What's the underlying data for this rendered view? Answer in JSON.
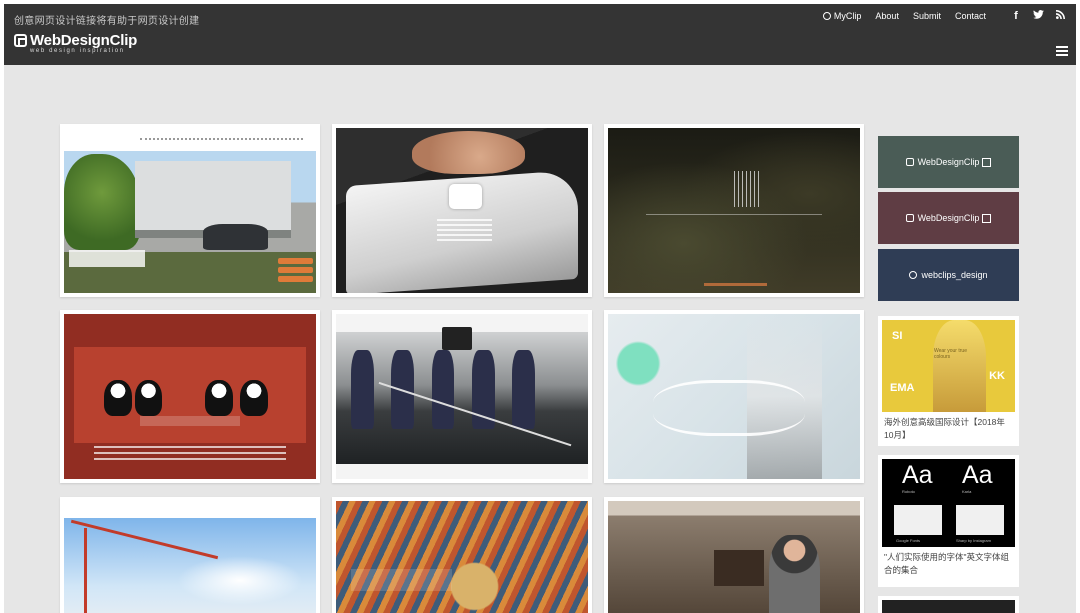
{
  "header": {
    "tagline": "创意网页设计链接将有助于网页设计创建",
    "logo_text": "WebDesignClip",
    "logo_sub": "web design inspiration",
    "nav": [
      {
        "label": "MyClip",
        "icon": "myclip-icon"
      },
      {
        "label": "About"
      },
      {
        "label": "Submit"
      },
      {
        "label": "Contact"
      }
    ],
    "social": [
      "facebook-icon",
      "twitter-icon",
      "rss-icon"
    ],
    "menu_icon": "hamburger-menu-icon",
    "bg_color": "#343434"
  },
  "sidebar": {
    "links": [
      {
        "label": "WebDesignClip",
        "color": "#4a5c56",
        "icon": "webdesignclip-logo-icon"
      },
      {
        "label": "WebDesignClip",
        "color": "#5f3d44",
        "icon": "webdesignclip-logo-icon"
      },
      {
        "label": "webclips_design",
        "color": "#2f3d55",
        "icon": "instagram-icon"
      }
    ],
    "posts": [
      {
        "caption": "海外创意高级国际设计【2018年10月】",
        "thumb_text": [
          "SI",
          "EMA",
          "KK",
          "Wear your true colours"
        ]
      },
      {
        "caption": "\"人们实际使用的字体\"英文字体组合的集合",
        "thumb_text": [
          "Aa",
          "Aa",
          "Roboto",
          "Karla",
          "Google Fonts",
          "Sharp by Instagram"
        ]
      }
    ]
  },
  "gallery": [
    {
      "name": "architecture-site"
    },
    {
      "name": "tofu-site"
    },
    {
      "name": "bar-site"
    },
    {
      "name": "law-office-site"
    },
    {
      "name": "kendo-site"
    },
    {
      "name": "pastel-site"
    },
    {
      "name": "construction-site"
    },
    {
      "name": "munch-exhibition-site"
    },
    {
      "name": "photo-studio-site"
    }
  ],
  "colors": {
    "page_bg": "#e6e6e6",
    "card_bg": "#ffffff"
  }
}
